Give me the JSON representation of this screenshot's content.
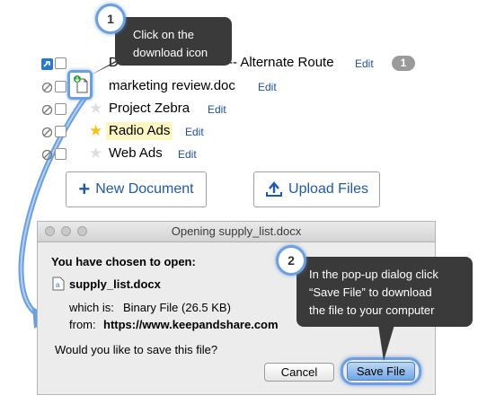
{
  "files": [
    {
      "name": "D",
      "name_tail": "-- Alternate Route",
      "edit": "Edit",
      "badge": "1",
      "starred": false
    },
    {
      "name": "marketing review.doc",
      "edit": "Edit",
      "starred": false
    },
    {
      "name": "Project Zebra",
      "edit": "Edit",
      "starred": false
    },
    {
      "name": "Radio Ads",
      "edit": "Edit",
      "starred": true
    },
    {
      "name": "Web Ads",
      "edit": "Edit",
      "starred": false
    }
  ],
  "actions": {
    "new_document": "New Document",
    "upload_files": "Upload Files"
  },
  "dialog": {
    "title": "Opening supply_list.docx",
    "heading": "You have chosen to open:",
    "filename": "supply_list.docx",
    "which_is_label": "which is:",
    "which_is_value": "Binary File (26.5 KB)",
    "from_label": "from:",
    "from_value": "https://www.keepandshare.com",
    "question": "Would you like to save this file?",
    "cancel": "Cancel",
    "save": "Save File"
  },
  "callouts": {
    "step1": {
      "number": "1",
      "line1": "Click on the",
      "line2": "download icon"
    },
    "step2": {
      "number": "2",
      "line1": "In the pop-up dialog click",
      "line2": "“Save File” to download",
      "line3": "the file to your computer"
    }
  },
  "colors": {
    "accent": "#6aa0e0",
    "link": "#1f4fa0",
    "callout_bg": "#3a3a3a",
    "star_on": "#f2c314"
  }
}
